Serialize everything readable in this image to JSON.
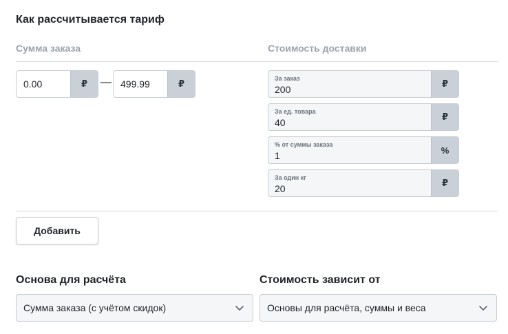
{
  "tariff": {
    "title": "Как рассчитывается тариф",
    "order_sum_header": "Сумма заказа",
    "delivery_cost_header": "Стоимость доставки",
    "range": {
      "from_value": "0.00",
      "to_value": "499.99",
      "separator": "—",
      "currency": "₽"
    },
    "costs": [
      {
        "label": "За заказ",
        "value": "200",
        "unit": "₽"
      },
      {
        "label": "За ед. товара",
        "value": "40",
        "unit": "₽"
      },
      {
        "label": "% от суммы заказа",
        "value": "1",
        "unit": "%"
      },
      {
        "label": "За один кг",
        "value": "20",
        "unit": "₽"
      }
    ],
    "add_button_label": "Добавить"
  },
  "calculation": {
    "basis_label": "Основа для расчёта",
    "basis_value": "Сумма заказа (с учётом скидок)",
    "depends_label": "Стоимость зависит от",
    "depends_value": "Основы для расчёта, суммы и веса",
    "chevron_icon": "chevron-down-icon"
  },
  "colors": {
    "addon_bg": "#c9d0d7",
    "field_bg": "#f4f6f8",
    "muted_header": "#9aa3ad"
  }
}
